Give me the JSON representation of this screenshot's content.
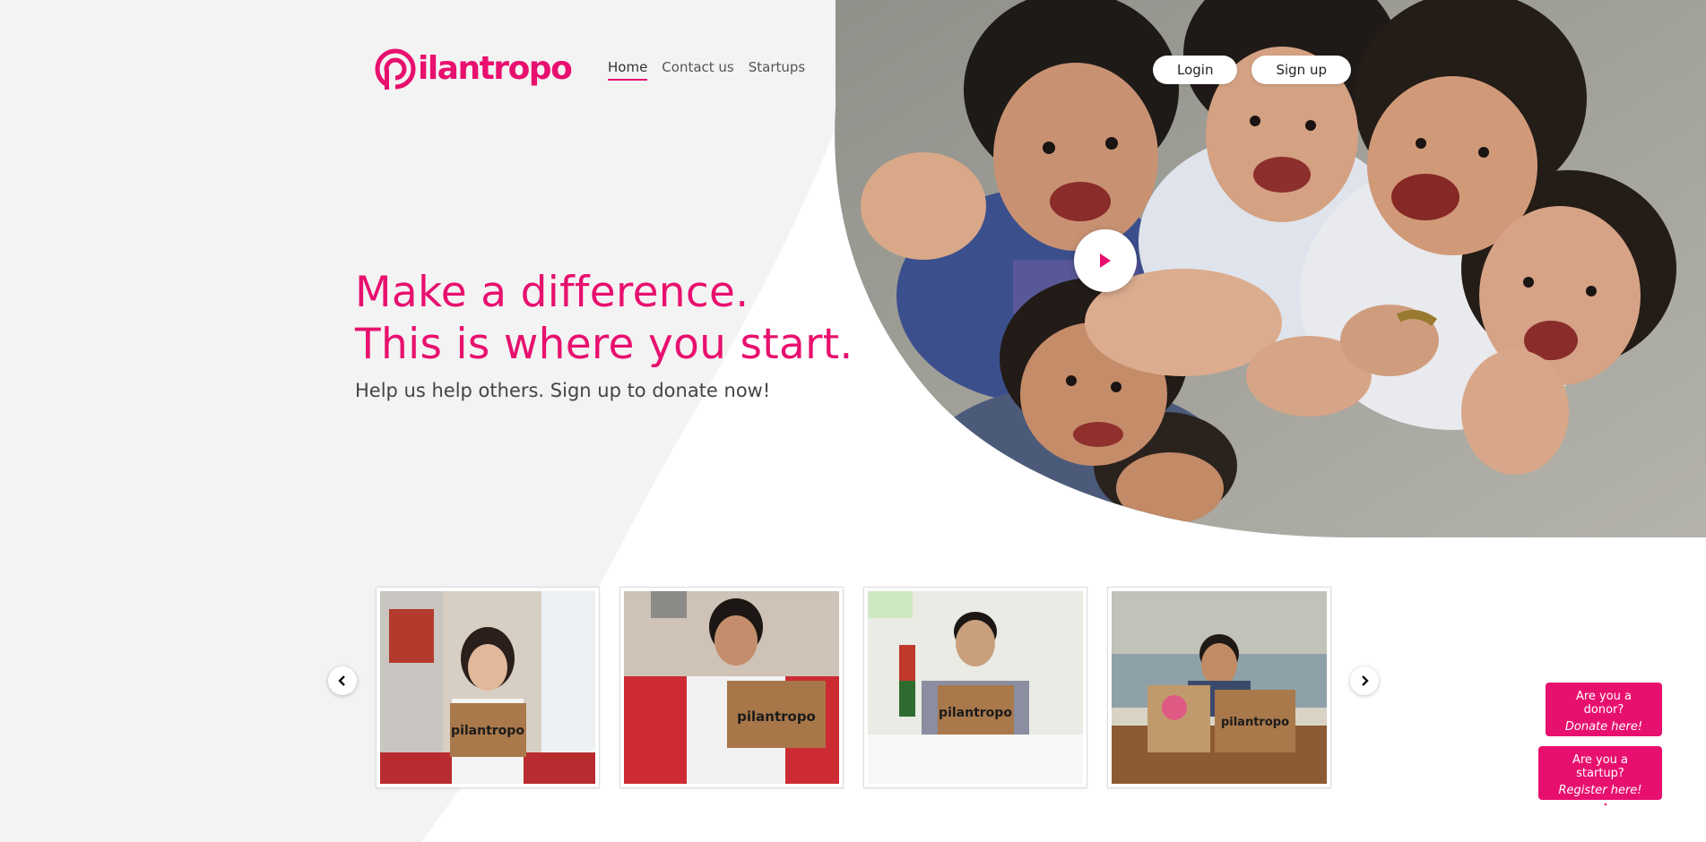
{
  "brand": {
    "name": "pilantropo",
    "logo_text": "ilantropo",
    "accent_color": "#e8106e",
    "background_color": "#f3f3f4"
  },
  "nav": {
    "items": [
      {
        "label": "Home",
        "active": true
      },
      {
        "label": "Contact us",
        "active": false
      },
      {
        "label": "Startups",
        "active": false
      }
    ]
  },
  "auth": {
    "login_label": "Login",
    "signup_label": "Sign up"
  },
  "hero": {
    "title_line1": "Make a difference.",
    "title_line2": "This is where you start.",
    "subtitle": "Help us help others. Sign up to donate now!",
    "photo_description_icon": "play-icon"
  },
  "carousel": {
    "prev_icon": "chevron-left-icon",
    "next_icon": "chevron-right-icon",
    "cards": [
      {
        "icon": "photo-icon"
      },
      {
        "icon": "photo-icon"
      },
      {
        "icon": "photo-icon"
      },
      {
        "icon": "photo-icon"
      }
    ]
  },
  "cta": {
    "donor_question": "Are you a donor?",
    "donor_action": "Donate here!",
    "donor_icon": "coins-icon",
    "startup_question": "Are you a startup?",
    "startup_action": "Register here!",
    "startup_icon": "rocket-icon"
  }
}
